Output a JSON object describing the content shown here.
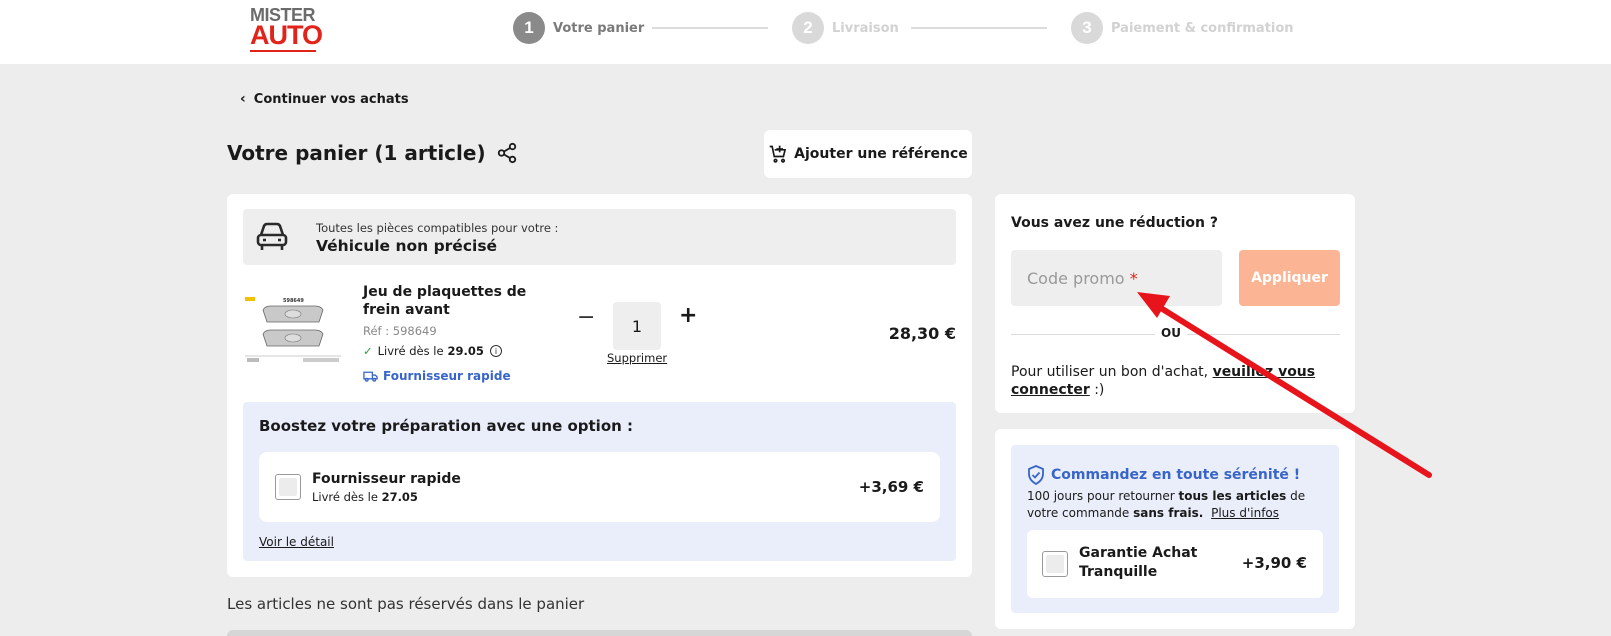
{
  "header": {
    "logo_line1": "MISTER",
    "logo_line2": "AUTO",
    "steps": [
      {
        "num": "1",
        "label": "Votre panier"
      },
      {
        "num": "2",
        "label": "Livraison"
      },
      {
        "num": "3",
        "label": "Paiement & confirmation"
      }
    ]
  },
  "nav": {
    "continue_label": "Continuer vos achats"
  },
  "cart": {
    "title": "Votre panier (1 article)",
    "add_reference_label": "Ajouter une référence",
    "vehicle": {
      "caption": "Toutes les pièces compatibles pour votre :",
      "name": "Véhicule non précisé"
    },
    "item": {
      "name": "Jeu de plaquettes de frein avant",
      "ref": "Réf : 598649",
      "delivery_prefix": "Livré dès le",
      "delivery_date": "29.05",
      "fast_supplier": "Fournisseur rapide",
      "quantity": "1",
      "remove_label": "Supprimer",
      "price": "28,30 €",
      "image_ref": "598649"
    },
    "boost": {
      "title": "Boostez votre préparation avec une option :",
      "option_name": "Fournisseur rapide",
      "option_delivery_prefix": "Livré dès le",
      "option_delivery_date": "27.05",
      "option_price": "+3,69 €",
      "detail_label": "Voir le détail"
    },
    "not_reserved": "Les articles ne sont pas réservés dans le panier"
  },
  "promo": {
    "question": "Vous avez une réduction ?",
    "placeholder": "Code promo",
    "required_mark": "*",
    "apply_label": "Appliquer",
    "or_label": "OU",
    "voucher_text": "Pour utiliser un bon d'achat,",
    "voucher_link": "veuillez vous connecter",
    "voucher_suffix": ":)"
  },
  "serenity": {
    "title": "Commandez en toute sérénité !",
    "text_1": "100 jours pour retourner",
    "text_bold_1": "tous les articles",
    "text_2": "de votre commande",
    "text_bold_2": "sans frais.",
    "more_info": "Plus d'infos",
    "guarantee_name": "Garantie Achat Tranquille",
    "guarantee_price": "+3,90 €"
  },
  "colors": {
    "brand_red": "#e2231a",
    "link_blue": "#3865c8",
    "apply_disabled": "#fcb594",
    "annotation_arrow": "#e8141b"
  }
}
